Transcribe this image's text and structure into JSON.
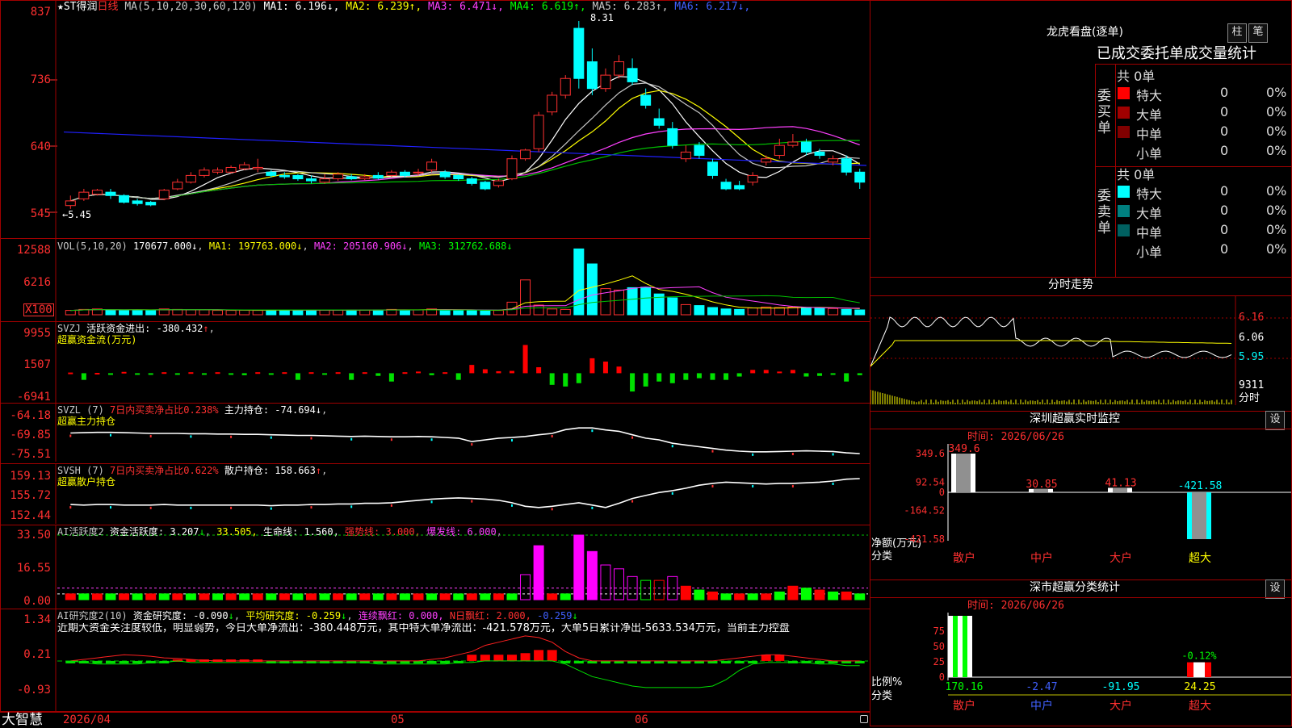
{
  "colors": {
    "up": "#ff3030",
    "down": "#00ffff",
    "grid": "#a00000",
    "ma1": "#ffffff",
    "ma2": "#ffff00",
    "ma3": "#ff40ff",
    "ma4": "#00c000",
    "ma5": "#c8c8c8",
    "ma6": "#2020ff"
  },
  "main": {
    "star_title": "★ST得润",
    "period": "日线",
    "ma_label": "MA(5,10,20,30,60,120)",
    "ma_items": [
      {
        "label": "MA1:",
        "value": "6.196",
        "arrow": "↓",
        "color": "#ffffff"
      },
      {
        "label": "MA2:",
        "value": "6.239",
        "arrow": "↑",
        "color": "#ffff00"
      },
      {
        "label": "MA3:",
        "value": "6.471",
        "arrow": "↓",
        "color": "#ff40ff"
      },
      {
        "label": "MA4:",
        "value": "6.619",
        "arrow": "↑",
        "color": "#00ff00"
      },
      {
        "label": "MA5:",
        "value": "6.283",
        "arrow": "↑",
        "color": "#c8c8c8"
      },
      {
        "label": "MA6:",
        "value": "6.217",
        "arrow": "↓",
        "color": "#4060ff"
      }
    ],
    "y_labels": [
      "837",
      "736",
      "640",
      "545"
    ],
    "high_mark": "8.31",
    "low_mark": "←5.45"
  },
  "volume": {
    "label": "VOL(5,10,20)",
    "v": "170677.000",
    "v_arrow": "↓",
    "ma1": "MA1: 197763.000",
    "ma1_arrow": "↓",
    "ma2": "MA2: 205160.906",
    "ma2_arrow": "↓",
    "ma3": "MA3: 312762.688",
    "ma3_arrow": "↓",
    "y_labels": [
      "12588",
      "6216"
    ],
    "unit": "X100"
  },
  "svzj": {
    "label": "SVZJ",
    "desc": "活跃资金进出: -380.432",
    "arrow": "↑",
    "sub": "超赢资金流(万元)",
    "y_labels": [
      "9955",
      "1507",
      "-6941"
    ]
  },
  "svzl": {
    "label": "SVZL (7)",
    "desc1": "7日内买卖净占比0.238%",
    "desc2": "主力持仓: -74.694",
    "arrow": "↓",
    "sub": "超赢主力持仓",
    "y_labels": [
      "-64.18",
      "-69.85",
      "-75.51"
    ]
  },
  "svsh": {
    "label": "SVSH (7)",
    "desc1": "7日内买卖净占比0.622%",
    "desc2": "散户持仓: 158.663",
    "arrow": "↑",
    "sub": "超赢散户持仓",
    "y_labels": [
      "159.13",
      "155.72",
      "152.44"
    ]
  },
  "ai_active": {
    "label": "AI活跃度2",
    "v1": "资金活跃度: 3.207",
    "a1": "↓",
    "v2": "33.505,",
    "v3": "生命线: 1.560,",
    "v4": "强势线: 3.000,",
    "v5": "爆发线: 6.000,",
    "y_labels": [
      "33.50",
      "16.55",
      "0.00"
    ]
  },
  "ai_research": {
    "label": "AI研究度2(10)",
    "v1": "资金研究度: -0.090",
    "a1": "↓",
    "v2": "平均研究度: -0.259",
    "a2": "↓",
    "v3": "连续飘红: 0.000,",
    "v4": "N日飘红: 2.000,",
    "v5": "-0.259",
    "a5": "↓",
    "note": "近期大资金关注度较低，明显弱势，今日大单净流出：-380.448万元，其中特大单净流出：-421.578万元，大单5日累计净出-5633.534万元，当前主力控盘",
    "y_labels": [
      "1.34",
      "0.21",
      "-0.93"
    ]
  },
  "bottom": {
    "brand": "大智慧",
    "dates": [
      "2026/04",
      "05",
      "06"
    ]
  },
  "dragon": {
    "title": "龙虎看盘(逐单)",
    "btn1": "柱",
    "btn2": "笔",
    "header": "已成交委托单成交量统计",
    "buy": {
      "side": "委买单",
      "total": "共 0单",
      "rows": [
        {
          "name": "特大",
          "val": "0",
          "pct": "0%",
          "color": "#ff0000"
        },
        {
          "name": "大单",
          "val": "0",
          "pct": "0%",
          "color": "#a00000"
        },
        {
          "name": "中单",
          "val": "0",
          "pct": "0%",
          "color": "#800000"
        },
        {
          "name": "小单",
          "val": "0",
          "pct": "0%",
          "color": ""
        }
      ]
    },
    "sell": {
      "side": "委卖单",
      "total": "共 0单",
      "rows": [
        {
          "name": "特大",
          "val": "0",
          "pct": "0%",
          "color": "#00ffff"
        },
        {
          "name": "大单",
          "val": "0",
          "pct": "0%",
          "color": "#008080"
        },
        {
          "name": "中单",
          "val": "0",
          "pct": "0%",
          "color": "#006060"
        },
        {
          "name": "小单",
          "val": "0",
          "pct": "0%",
          "color": ""
        }
      ]
    }
  },
  "intraday": {
    "title": "分时走势",
    "y_labels": [
      "6.16",
      "6.06",
      "5.95"
    ],
    "vol_label": "9311",
    "time_label": "分时"
  },
  "monitor": {
    "title": "深圳超赢实时监控",
    "set": "设",
    "time": "时间: 2026/06/26",
    "y_labels": [
      "349.6",
      "92.54",
      "0",
      "-164.52",
      "-421.58"
    ],
    "ylabel": "净额(万元)",
    "xlabel": "分类",
    "cats": [
      "散户",
      "中户",
      "大户",
      "超大"
    ],
    "values": [
      "349.6",
      "30.85",
      "41.13",
      "-421.58"
    ]
  },
  "stats": {
    "title": "深市超赢分类统计",
    "set": "设",
    "time": "时间: 2026/06/26",
    "y_labels": [
      "75",
      "50",
      "25",
      "0"
    ],
    "ylabel": "比例%",
    "xlabel": "分类",
    "cats": [
      "散户",
      "中户",
      "大户",
      "超大"
    ],
    "values": [
      "170.16",
      "-2.47",
      "-91.95",
      "24.25"
    ],
    "top_label": "-0.12%"
  },
  "chart_data": [
    {
      "type": "candlestick",
      "title": "★ST得润 日线",
      "ylim": [
        5.45,
        8.37
      ],
      "candles": [
        [
          5.55,
          5.62,
          5.5,
          5.7
        ],
        [
          5.65,
          5.75,
          5.62,
          5.8
        ],
        [
          5.72,
          5.78,
          5.7,
          5.8
        ],
        [
          5.75,
          5.7,
          5.65,
          5.8
        ],
        [
          5.7,
          5.6,
          5.58,
          5.72
        ],
        [
          5.62,
          5.58,
          5.55,
          5.65
        ],
        [
          5.6,
          5.56,
          5.54,
          5.62
        ],
        [
          5.65,
          5.78,
          5.63,
          5.8
        ],
        [
          5.8,
          5.9,
          5.78,
          5.95
        ],
        [
          5.9,
          6.0,
          5.88,
          6.05
        ],
        [
          6.0,
          6.08,
          5.97,
          6.12
        ],
        [
          6.05,
          6.08,
          6.02,
          6.12
        ],
        [
          6.05,
          6.12,
          6.03,
          6.15
        ],
        [
          6.1,
          6.16,
          6.08,
          6.2
        ],
        [
          6.1,
          6.12,
          6.05,
          6.25
        ],
        [
          6.05,
          6.0,
          5.97,
          6.08
        ],
        [
          6.0,
          5.98,
          5.95,
          6.05
        ],
        [
          6.0,
          5.95,
          5.92,
          6.02
        ],
        [
          5.95,
          5.92,
          5.88,
          6.0
        ],
        [
          5.9,
          5.95,
          5.88,
          6.02
        ],
        [
          5.95,
          6.02,
          5.92,
          6.05
        ],
        [
          5.98,
          5.95,
          5.93,
          6.02
        ],
        [
          5.95,
          5.98,
          5.93,
          6.02
        ],
        [
          6.0,
          5.96,
          5.94,
          6.05
        ],
        [
          6.0,
          6.05,
          5.98,
          6.08
        ],
        [
          6.05,
          6.0,
          5.97,
          6.08
        ],
        [
          6.05,
          6.05,
          6.0,
          6.1
        ],
        [
          6.08,
          6.2,
          6.05,
          6.25
        ],
        [
          6.05,
          5.98,
          5.95,
          6.08
        ],
        [
          6.0,
          5.95,
          5.92,
          6.02
        ],
        [
          5.95,
          5.88,
          5.85,
          5.98
        ],
        [
          5.9,
          5.8,
          5.78,
          5.92
        ],
        [
          5.85,
          5.92,
          5.82,
          5.95
        ],
        [
          5.95,
          6.25,
          5.93,
          6.3
        ],
        [
          6.25,
          6.38,
          6.22,
          6.4
        ],
        [
          6.4,
          6.9,
          6.35,
          6.95
        ],
        [
          6.95,
          7.2,
          6.9,
          7.25
        ],
        [
          7.2,
          7.45,
          7.15,
          7.5
        ],
        [
          8.2,
          7.45,
          7.3,
          8.31
        ],
        [
          7.7,
          7.3,
          7.2,
          7.9
        ],
        [
          7.3,
          7.5,
          7.25,
          7.6
        ],
        [
          7.5,
          7.7,
          7.45,
          7.8
        ],
        [
          7.6,
          7.4,
          7.35,
          7.75
        ],
        [
          7.2,
          7.05,
          7.0,
          7.3
        ],
        [
          6.85,
          6.75,
          6.7,
          7.0
        ],
        [
          6.7,
          6.45,
          6.4,
          6.8
        ],
        [
          6.25,
          6.35,
          6.2,
          6.45
        ],
        [
          6.45,
          6.3,
          6.25,
          6.5
        ],
        [
          6.2,
          6.0,
          5.95,
          6.25
        ],
        [
          5.9,
          5.8,
          5.78,
          5.95
        ],
        [
          5.85,
          5.8,
          5.78,
          5.92
        ],
        [
          5.9,
          6.0,
          5.85,
          6.05
        ],
        [
          6.2,
          6.25,
          6.15,
          6.3
        ],
        [
          6.3,
          6.45,
          6.25,
          6.55
        ],
        [
          6.45,
          6.5,
          6.42,
          6.62
        ],
        [
          6.5,
          6.35,
          6.3,
          6.55
        ],
        [
          6.35,
          6.3,
          6.25,
          6.4
        ],
        [
          6.2,
          6.25,
          6.15,
          6.3
        ],
        [
          6.25,
          6.05,
          6.0,
          6.3
        ],
        [
          6.05,
          5.9,
          5.8,
          6.1
        ]
      ]
    },
    {
      "type": "bar",
      "title": "VOL(5,10,20)",
      "ylim": [
        0,
        14000
      ],
      "values": [
        900,
        1100,
        1200,
        1000,
        900,
        1000,
        950,
        1200,
        1100,
        1000,
        1000,
        900,
        900,
        950,
        900,
        1000,
        1000,
        950,
        900,
        1000,
        1000,
        950,
        1000,
        1000,
        1100,
        1000,
        1000,
        1200,
        1000,
        950,
        900,
        800,
        900,
        2600,
        7200,
        2000,
        1200,
        1100,
        13600,
        10500,
        5400,
        5100,
        5600,
        5700,
        4300,
        3500,
        2100,
        1900,
        1500,
        1200,
        1100,
        1400,
        1600,
        1500,
        1600,
        1500,
        1400,
        1300,
        1100,
        1000
      ]
    },
    {
      "type": "bar",
      "title": "SVZJ",
      "ylim": [
        -6941,
        12000
      ],
      "values": [
        200,
        -2000,
        100,
        -500,
        400,
        -300,
        -400,
        300,
        -400,
        300,
        -200,
        300,
        -400,
        -600,
        300,
        -400,
        300,
        -2000,
        300,
        -400,
        300,
        -2000,
        300,
        -800,
        -2500,
        300,
        500,
        -600,
        300,
        -2000,
        2500,
        1200,
        600,
        700,
        8500,
        1800,
        -3500,
        -4000,
        -3000,
        4500,
        3500,
        2000,
        -5500,
        -4000,
        -2500,
        -3000,
        -2000,
        -1500,
        -2000,
        -2000,
        -1000,
        1000,
        1000,
        500,
        1000,
        -1000,
        -800,
        -500,
        -2500,
        -600
      ]
    },
    {
      "type": "line",
      "title": "SVZL",
      "ylim": [
        -75.51,
        -64.18
      ],
      "values": [
        -69.5,
        -69.4,
        -69.3,
        -69.3,
        -69.4,
        -69.5,
        -69.6,
        -69.6,
        -69.6,
        -69.7,
        -69.7,
        -69.8,
        -69.8,
        -69.9,
        -69.9,
        -70.0,
        -70.1,
        -70.2,
        -70.2,
        -70.3,
        -70.4,
        -70.5,
        -70.4,
        -70.5,
        -70.6,
        -70.6,
        -70.5,
        -70.6,
        -70.8,
        -71.0,
        -72.0,
        -71.5,
        -71.0,
        -70.8,
        -70.5,
        -70.0,
        -69.6,
        -68.5,
        -68.0,
        -68.0,
        -68.6,
        -69.0,
        -70.0,
        -71.0,
        -71.5,
        -72.5,
        -73.0,
        -73.5,
        -74.0,
        -74.5,
        -74.8,
        -75.0,
        -75.0,
        -74.9,
        -74.8,
        -74.7,
        -74.8,
        -74.9,
        -75.3,
        -75.5
      ]
    },
    {
      "type": "line",
      "title": "SVSH",
      "ylim": [
        152.44,
        159.13
      ],
      "values": [
        154.3,
        154.2,
        154.3,
        154.3,
        154.2,
        154.2,
        154.2,
        154.3,
        154.2,
        154.2,
        154.2,
        154.2,
        154.2,
        154.2,
        154.2,
        154.1,
        154.2,
        154.2,
        154.3,
        154.3,
        154.4,
        154.4,
        154.5,
        154.5,
        154.6,
        154.8,
        155.0,
        155.2,
        155.3,
        155.4,
        155.3,
        155.2,
        155.0,
        154.6,
        154.0,
        153.8,
        154.0,
        154.3,
        154.6,
        154.2,
        153.8,
        154.5,
        155.3,
        155.8,
        156.3,
        156.6,
        157.0,
        157.5,
        157.8,
        158.0,
        157.9,
        157.8,
        157.7,
        157.8,
        157.8,
        157.9,
        158.0,
        158.2,
        158.5,
        158.6
      ]
    },
    {
      "type": "bar",
      "title": "AI活跃度2",
      "ylim": [
        0,
        33.5
      ],
      "values": [
        3,
        3,
        3,
        3,
        3,
        3,
        3,
        3,
        3,
        3,
        3,
        3,
        3,
        3,
        3,
        3,
        3,
        3,
        3,
        3,
        3,
        3,
        3,
        3,
        3,
        3,
        3,
        3,
        3,
        3,
        3,
        3,
        3,
        3,
        13,
        28,
        3,
        3,
        33.5,
        25,
        18,
        16,
        12,
        10,
        10,
        12,
        7,
        5,
        4,
        3,
        3,
        3,
        3,
        4,
        7,
        6,
        5,
        4,
        4,
        3
      ]
    },
    {
      "type": "bar",
      "title": "AI研究度2(10)",
      "ylim": [
        -0.93,
        1.34
      ],
      "values": [
        -0.05,
        -0.08,
        -0.05,
        -0.05,
        -0.05,
        -0.05,
        -0.05,
        -0.05,
        0.05,
        0.05,
        0.05,
        0.05,
        0.05,
        0.05,
        0.05,
        -0.05,
        -0.05,
        -0.05,
        -0.05,
        -0.05,
        -0.05,
        -0.05,
        -0.05,
        -0.05,
        -0.05,
        -0.05,
        -0.05,
        -0.05,
        -0.05,
        -0.05,
        0.2,
        0.2,
        0.2,
        0.2,
        0.25,
        0.35,
        0.35,
        -0.05,
        -0.08,
        -0.08,
        -0.08,
        -0.08,
        -0.08,
        -0.08,
        -0.08,
        -0.08,
        -0.08,
        -0.08,
        -0.08,
        -0.08,
        -0.08,
        -0.08,
        0.2,
        0.2,
        -0.05,
        -0.05,
        -0.05,
        -0.05,
        -0.05,
        -0.05
      ]
    }
  ]
}
